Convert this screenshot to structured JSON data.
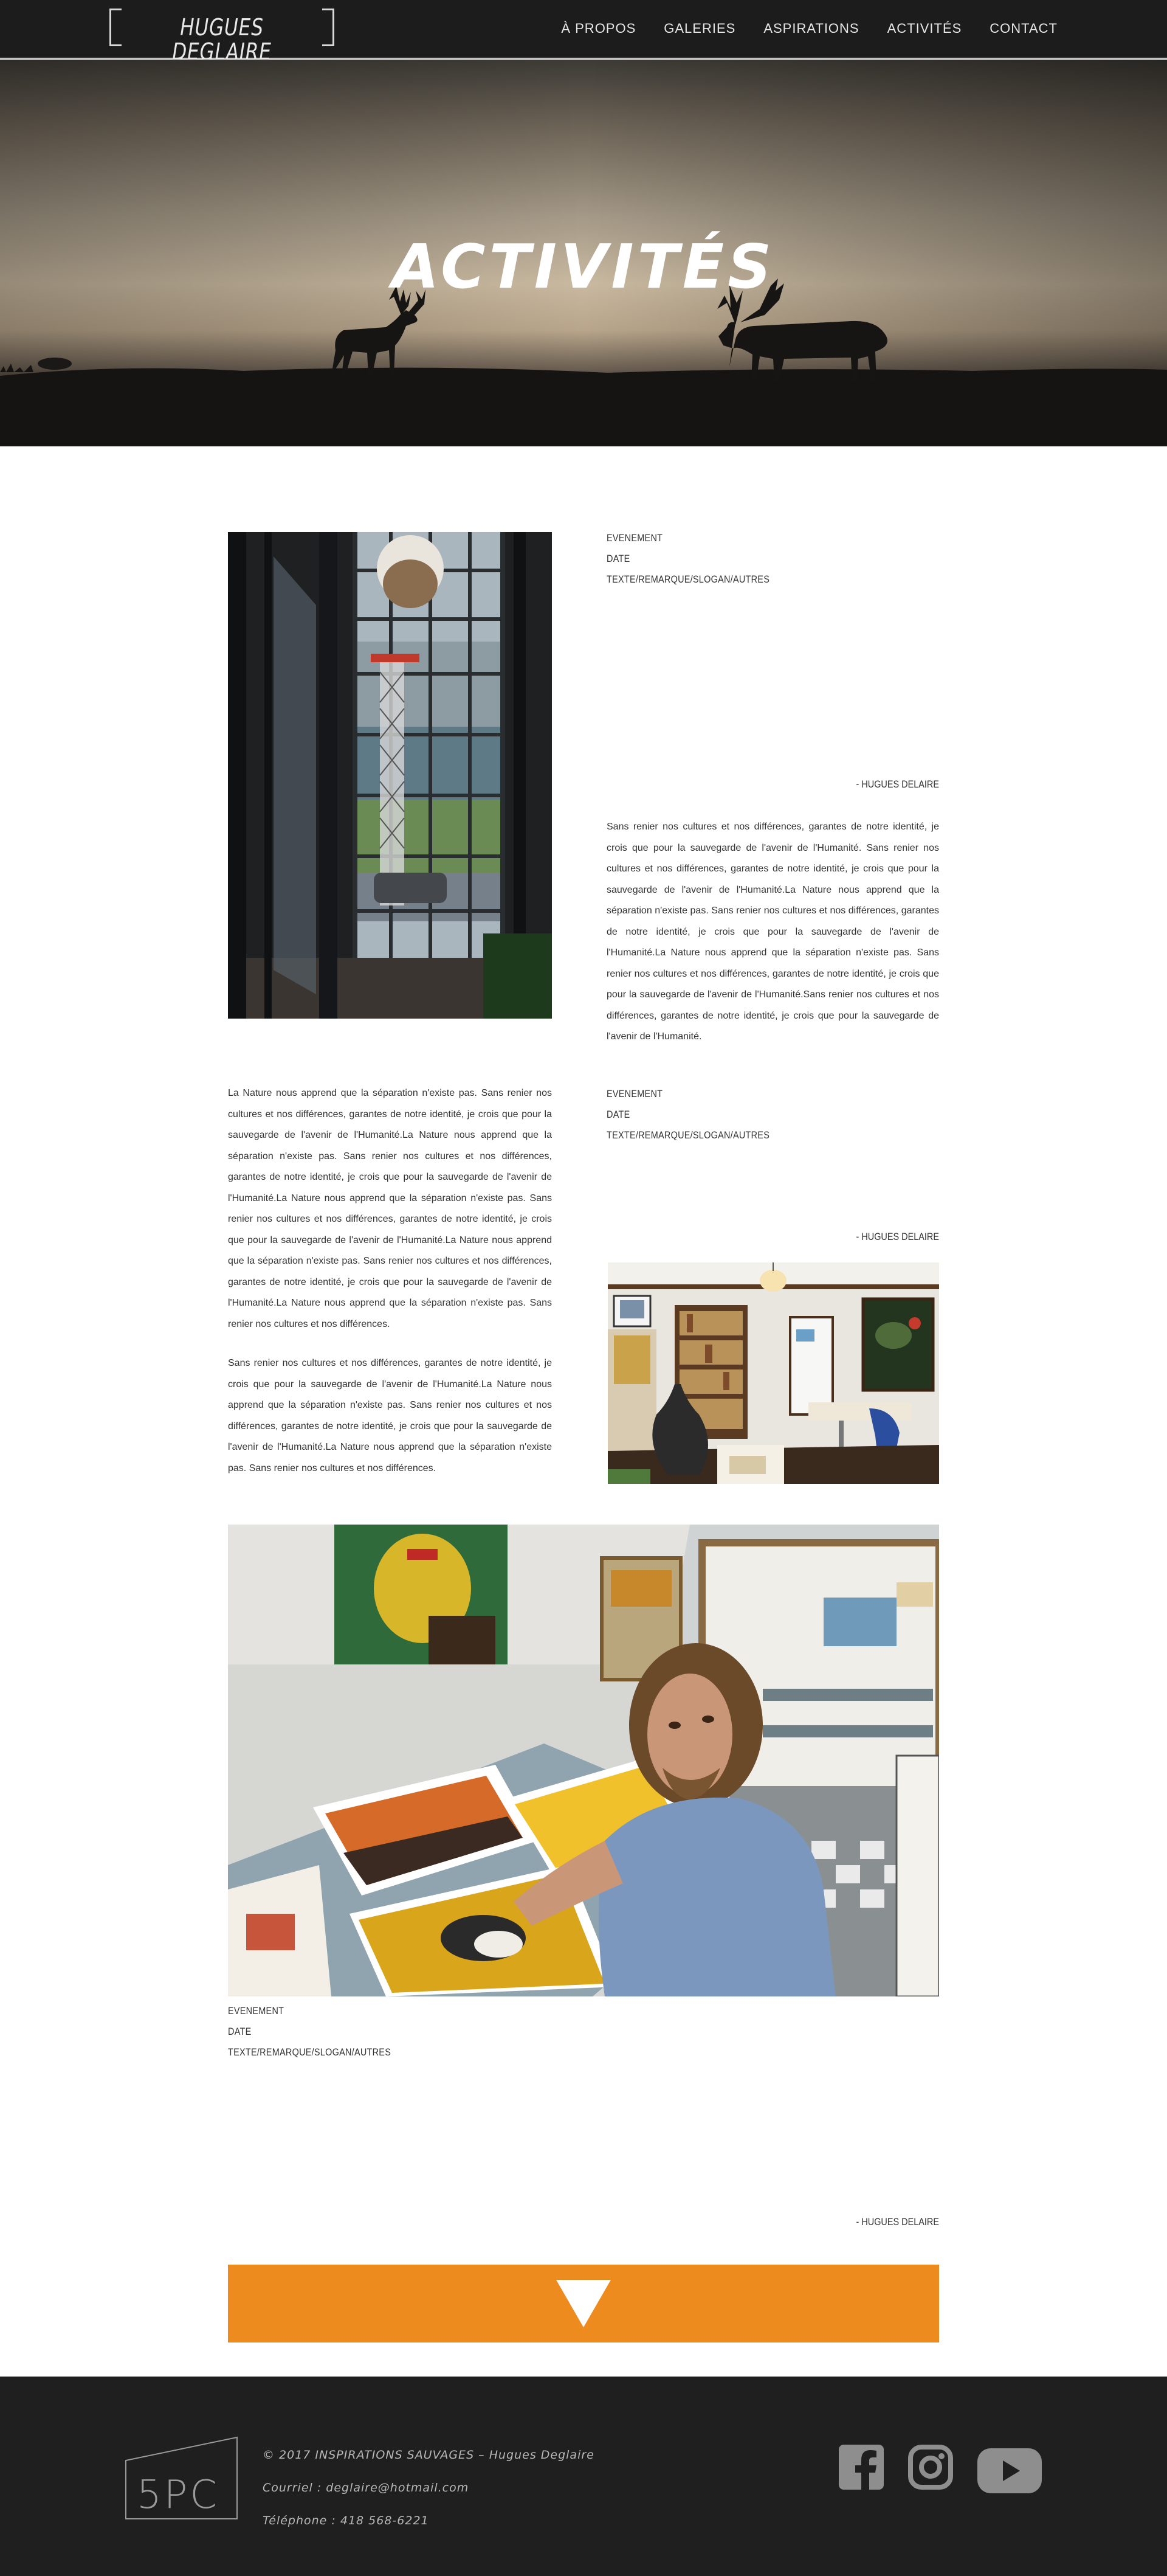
{
  "header": {
    "logo_text": "HUGUES DEGLAIRE",
    "nav": [
      {
        "label": "À PROPOS"
      },
      {
        "label": "GALERIES"
      },
      {
        "label": "ASPIRATIONS"
      },
      {
        "label": "ACTIVITÉS"
      },
      {
        "label": "CONTACT"
      }
    ]
  },
  "hero": {
    "title": "ACTIVITÉS"
  },
  "activities": [
    {
      "event": "EVENEMENT",
      "date": "DATE",
      "text": "TEXTE/REMARQUE/SLOGAN/AUTRES",
      "signature": "- HUGUES DELAIRE",
      "paragraph": "Sans renier nos cultures et nos différences, garantes de notre identité, je crois que pour la sauvegarde de l'avenir de l'Humanité. Sans renier nos cultures et nos différences, garantes de notre identité, je crois que pour la sauvegarde de l'avenir de l'Humanité.La Nature nous apprend que la séparation n'existe pas. Sans renier nos cultures et nos différences, garantes de notre identité, je crois que pour la sauvegarde de l'avenir de l'Humanité.La Nature nous apprend que la séparation n'existe pas. Sans renier nos cultures et nos différences, garantes de notre identité, je crois que pour la sauvegarde de l'avenir de l'Humanité.Sans renier nos cultures et nos différences, garantes de notre identité, je crois que pour la sauvegarde de l'avenir de l'Humanité."
    },
    {
      "event": "EVENEMENT",
      "date": "DATE",
      "text": "TEXTE/REMARQUE/SLOGAN/AUTRES",
      "signature": "- HUGUES DELAIRE",
      "paragraph_1": "La Nature nous apprend que la séparation n'existe pas. Sans renier nos cultures et nos différences, garantes de notre identité, je crois que pour la sauvegarde de l'avenir de l'Humanité.La Nature nous apprend que la séparation n'existe pas. Sans renier nos cultures et nos différences, garantes de notre identité, je crois que pour la sauvegarde de l'avenir de l'Humanité.La Nature nous apprend que la séparation n'existe pas. Sans renier nos cultures et nos différences, garantes de notre identité, je crois que pour la sauvegarde de l'avenir de l'Humanité.La Nature nous apprend que la séparation n'existe pas. Sans renier nos cultures et nos différences, garantes de notre identité, je crois que pour la sauvegarde de l'avenir de l'Humanité.La Nature nous apprend que la séparation n'existe pas. Sans renier nos cultures et nos différences.",
      "paragraph_2": "Sans renier nos cultures et nos différences, garantes de notre identité, je crois que pour la sauvegarde de l'avenir de l'Humanité.La Nature nous apprend que la séparation n'existe pas. Sans renier nos cultures et nos différences, garantes de notre identité, je crois que pour la sauvegarde de l'avenir de l'Humanité.La Nature nous apprend que la séparation n'existe pas. Sans renier nos cultures et nos différences."
    },
    {
      "event": "EVENEMENT",
      "date": "DATE",
      "text": "TEXTE/REMARQUE/SLOGAN/AUTRES",
      "signature": "- HUGUES DELAIRE"
    }
  ],
  "footer": {
    "logo_text": "5PC",
    "copyright": "© 2017 INSPIRATIONS SAUVAGES – Hugues Deglaire",
    "email": "Courriel : deglaire@hotmail.com",
    "phone": "Téléphone : 418 568-6221",
    "social": [
      "facebook-icon",
      "instagram-icon",
      "youtube-icon"
    ]
  },
  "colors": {
    "header_bg": "#1c1c1c",
    "accent": "#ee8b1e",
    "footer_bg": "#1f1f1f"
  }
}
